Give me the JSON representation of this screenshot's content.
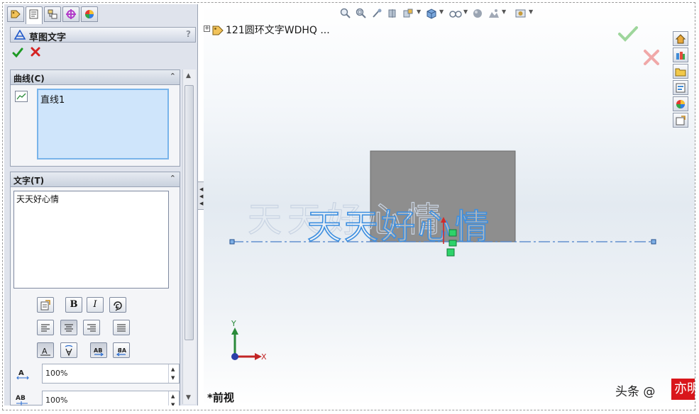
{
  "panel_tabs": [
    "feature-manager-icon",
    "property-manager-icon",
    "configuration-manager-icon",
    "dimxpert-icon",
    "display-manager-icon"
  ],
  "property_manager": {
    "title": "草图文字",
    "help": "?",
    "ok_icon": "check-icon",
    "cancel_icon": "close-icon"
  },
  "curves_group": {
    "header": "曲线(C)",
    "collapse": "⌃",
    "items": [
      "直线1"
    ]
  },
  "text_group": {
    "header": "文字(T)",
    "collapse": "⌃",
    "text": "天天好心情",
    "bold": "B",
    "italic": "I",
    "width_value": "100%",
    "spacing_value": "100%",
    "width_icon_label": "A",
    "spacing_icon_label": "AB"
  },
  "viewport": {
    "tree_label": "121圆环文字WDHQ ...",
    "tree_expand": "+",
    "sketch_text": "天天好心情",
    "view_name": "*前视",
    "axis_y": "Y",
    "axis_x": "X",
    "confirm_ok_icon": "check-icon",
    "confirm_cancel_icon": "close-icon"
  },
  "watermark": {
    "prefix": "头条 @",
    "name": "亦明图记"
  },
  "colors": {
    "sketch_text": "#3d8fe0",
    "block": "#8a8a8a",
    "centerline": "#4a7fc8",
    "accent_red": "#d9161b"
  }
}
